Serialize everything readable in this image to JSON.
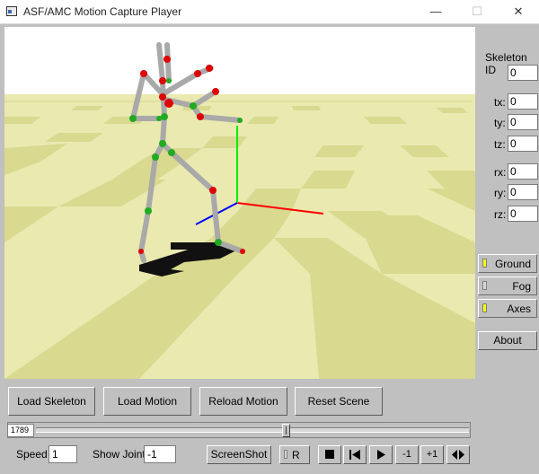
{
  "window": {
    "title": "ASF/AMC Motion Capture Player",
    "min_glyph": "—",
    "max_glyph": "☐",
    "close_glyph": "✕"
  },
  "side_panel": {
    "skeleton_id_label": "Skeleton ID",
    "skeleton_id_value": "0",
    "tx_label": "tx:",
    "tx_value": "0",
    "ty_label": "ty:",
    "ty_value": "0",
    "tz_label": "tz:",
    "tz_value": "0",
    "rx_label": "rx:",
    "rx_value": "0",
    "ry_label": "ry:",
    "ry_value": "0",
    "rz_label": "rz:",
    "rz_value": "0",
    "toggles": {
      "ground": {
        "label": "Ground",
        "on": true
      },
      "fog": {
        "label": "Fog",
        "on": false
      },
      "axes": {
        "label": "Axes",
        "on": true
      }
    },
    "about_label": "About"
  },
  "actions": {
    "load_skeleton": "Load Skeleton",
    "load_motion": "Load Motion",
    "reload_motion": "Reload Motion",
    "reset_scene": "Reset Scene"
  },
  "timeline": {
    "frame_value": "1789",
    "position_fraction": 0.58
  },
  "bottom": {
    "speed_label": "Speed",
    "speed_value": "1",
    "show_joint_label": "Show Joint",
    "show_joint_value": "-1",
    "screenshot_label": "ScreenShot",
    "record_label": "R",
    "step_back_label": "-1",
    "step_forward_label": "+1"
  },
  "colors": {
    "ground_light": "#e9e9b0",
    "ground_dark": "#d9d990",
    "sky": "#ffffff",
    "bone": "#a9a9a9",
    "joint_red": "#dd0000",
    "joint_green": "#22aa22",
    "axis_x": "#ff0000",
    "axis_y": "#00ee00",
    "axis_z": "#0000ff",
    "led_on": "#ffff00"
  },
  "icons": [
    "stop-icon",
    "skip-start-icon",
    "play-icon",
    "bounce-icon"
  ]
}
